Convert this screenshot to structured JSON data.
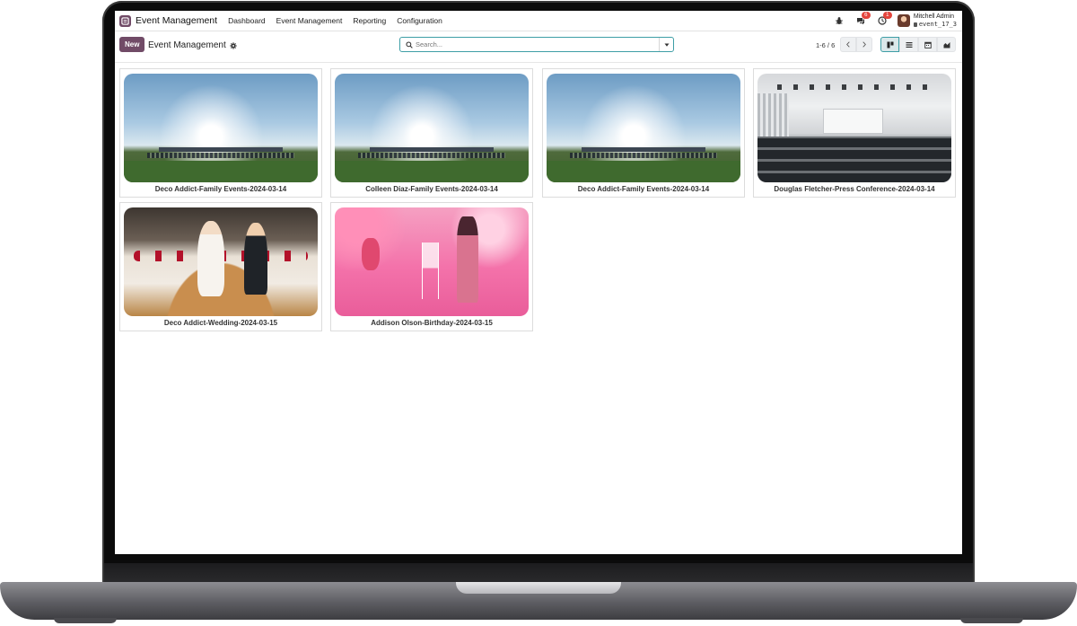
{
  "app": {
    "name": "Event Management",
    "menu": [
      "Dashboard",
      "Event Management",
      "Reporting",
      "Configuration"
    ]
  },
  "systray": {
    "messages_badge": "6",
    "activity_badge": "1",
    "user_name": "Mitchell Admin",
    "database": "event_17_3"
  },
  "control": {
    "new_label": "New",
    "breadcrumb": "Event Management",
    "search_placeholder": "Search...",
    "pager": "1-6 / 6"
  },
  "colors": {
    "brand": "#714b67",
    "accent": "#3e9ea6",
    "badge": "#e4443c"
  },
  "cards": [
    {
      "title": "Deco Addict-Family Events-2024-03-14",
      "image": "field"
    },
    {
      "title": "Colleen Diaz-Family Events-2024-03-14",
      "image": "field"
    },
    {
      "title": "Deco Addict-Family Events-2024-03-14",
      "image": "field"
    },
    {
      "title": "Douglas Fletcher-Press Conference-2024-03-14",
      "image": "conference-room"
    },
    {
      "title": "Deco Addict-Wedding-2024-03-15",
      "image": "wedding-cake"
    },
    {
      "title": "Addison Olson-Birthday-2024-03-15",
      "image": "birthday-wine"
    }
  ]
}
